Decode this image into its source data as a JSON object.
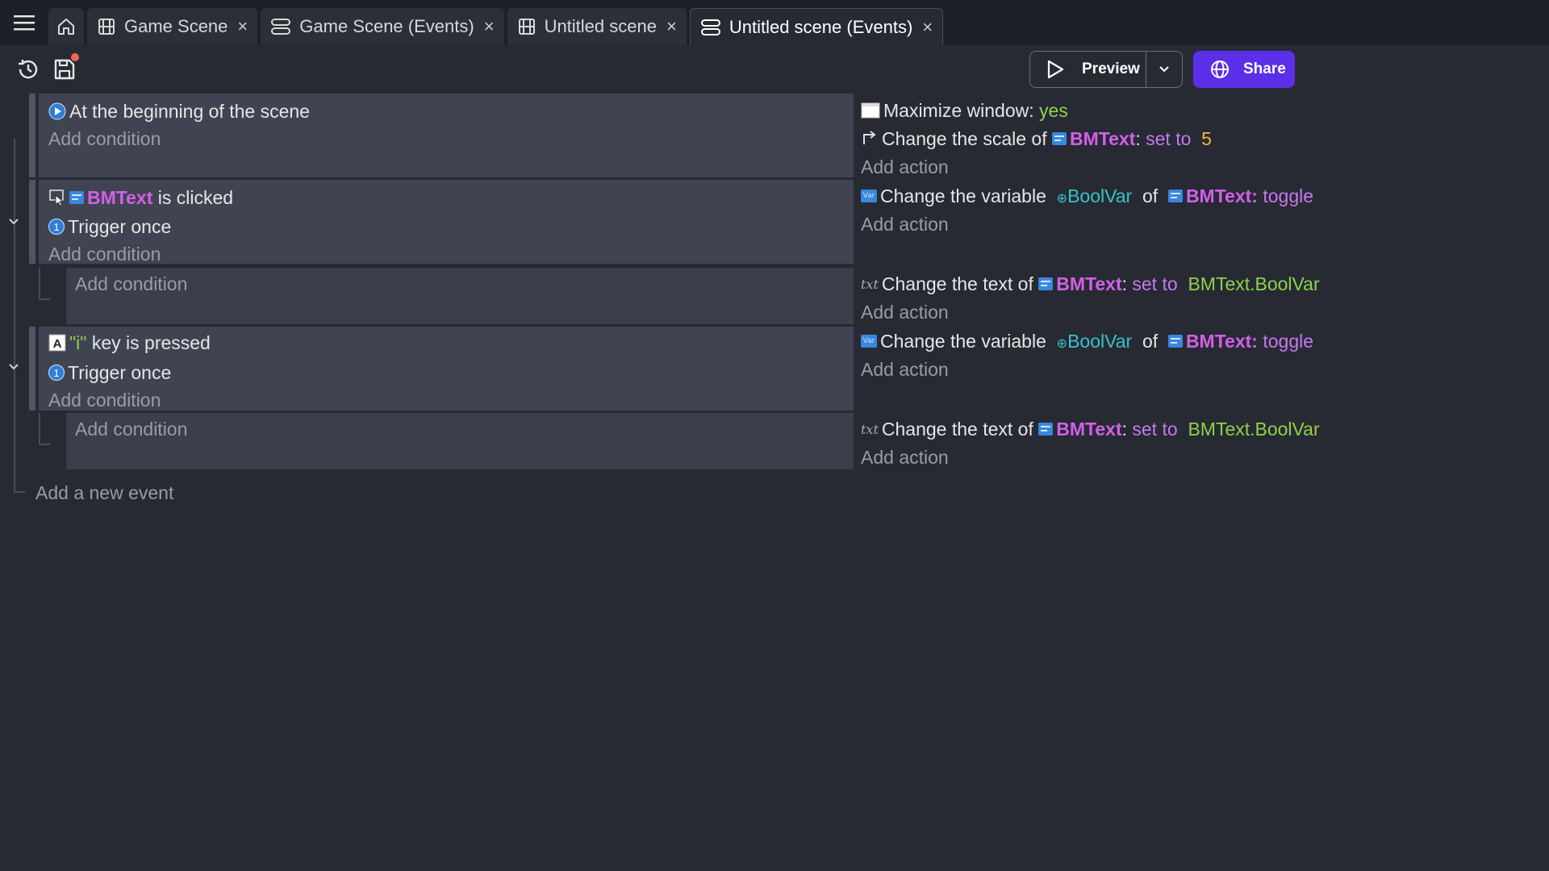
{
  "tabs": [
    {
      "label": "Game Scene",
      "icon": "film-icon",
      "active": false
    },
    {
      "label": "Game Scene (Events)",
      "icon": "events-icon",
      "active": false
    },
    {
      "label": "Untitled scene",
      "icon": "film-icon",
      "active": false
    },
    {
      "label": "Untitled scene (Events)",
      "icon": "events-icon",
      "active": true
    }
  ],
  "toolbar": {
    "preview_label": "Preview",
    "share_label": "Share",
    "share_color": "#5b2ee8"
  },
  "events": [
    {
      "conditions": [
        "At the beginning of the scene"
      ],
      "add_condition": "Add condition",
      "actions": {
        "a1": {
          "text": "Maximize window:",
          "value": "yes"
        },
        "a2": {
          "text": "Change the scale of",
          "object": "BMText",
          "colon": ":",
          "op": "set to",
          "value": "5"
        },
        "add_action": "Add action"
      }
    },
    {
      "conditions": {
        "obj": "BMText",
        "suffix": "is clicked",
        "trigger": "Trigger once"
      },
      "add_condition": "Add condition",
      "actions": {
        "a1": {
          "text": "Change the variable",
          "var": "BoolVar",
          "of": "of",
          "object": "BMText",
          "colon": ":",
          "op": "toggle"
        },
        "add_action": "Add action"
      },
      "sub": {
        "add_condition": "Add condition",
        "a1": {
          "text": "Change the text of",
          "object": "BMText",
          "colon": ":",
          "op": "set to",
          "value": "BMText.BoolVar"
        },
        "add_action": "Add action"
      }
    },
    {
      "conditions": {
        "key": "\"i\"",
        "suffix": "key is pressed",
        "trigger": "Trigger once"
      },
      "add_condition": "Add condition",
      "actions": {
        "a1": {
          "text": "Change the variable",
          "var": "BoolVar",
          "of": "of",
          "object": "BMText",
          "colon": ":",
          "op": "toggle"
        },
        "add_action": "Add action"
      },
      "sub": {
        "add_condition": "Add condition",
        "a1": {
          "text": "Change the text of",
          "object": "BMText",
          "colon": ":",
          "op": "set to",
          "value": "BMText.BoolVar"
        },
        "add_action": "Add action"
      }
    }
  ],
  "add_new_event": "Add a new event"
}
